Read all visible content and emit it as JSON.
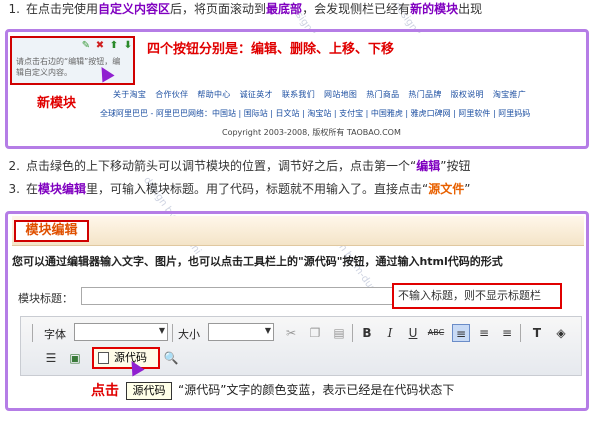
{
  "steps": [
    {
      "num": "1.",
      "pre": "在点击完使用",
      "h1": "自定义内容区",
      "mid1": "后，将页面滚动到",
      "h2": "最底部",
      "mid2": "，会发现侧栏已经有",
      "h3": "新的模块",
      "post": "出现"
    },
    {
      "num": "2.",
      "pre": "点击绿色的上下移动箭头可以调节模块的位置，调节好之后，点击第一个“",
      "h1": "编辑",
      "post": "”按钮"
    },
    {
      "num": "3.",
      "pre": "在",
      "h1": "模块编辑",
      "mid1": "里，可输入模块标题。用了代码，标题就不用输入了。直接点击“",
      "h2": "源文件",
      "post": "”"
    }
  ],
  "panel1": {
    "callout": "四个按钮分别是：编辑、删除、上移、下移",
    "new_module_label": "新模块",
    "module_text": "请点击右边的“编辑”按钮，编辑自定义内容。",
    "icons": [
      "edit-icon",
      "delete-icon",
      "move-up-icon",
      "move-down-icon"
    ],
    "footer_links": [
      "关于淘宝",
      "合作伙伴",
      "帮助中心",
      "诚征英才",
      "联系我们",
      "网站地图",
      "热门商品",
      "热门品牌",
      "版权说明",
      "淘宝推广"
    ],
    "footer_line2": "全球阿里巴巴 - 阿里巴巴网络：中国站 | 国际站 | 日文站 | 淘宝站 | 支付宝 | 中国雅虎 | 雅虎口碑网 | 阿里软件 | 阿里妈妈",
    "copyright": "Copyright 2003-2008, 版权所有 TAOBAO.COM"
  },
  "panel2": {
    "title": "模块编辑",
    "description": "您可以通过编辑器输入文字、图片，也可以点击工具栏上的\"源代码\"按钮，通过输入html代码的形式",
    "title_field_label": "模块标题：",
    "title_field_value": "",
    "title_note": "不输入标题，则不显示标题栏",
    "toolbar": {
      "font_label": "字体",
      "size_label": "大小",
      "source_button": "源代码",
      "tooltip": "源代码"
    },
    "click_label": "点击",
    "bottom_note": "“源代码”文字的颜色变蓝，表示已经是在代码状态下"
  },
  "watermark": "design by m-dushi",
  "colors": {
    "accent_purple": "#8000c0",
    "accent_orange": "#e86000",
    "alert_red": "#e00000",
    "box_purple": "#b57de6"
  }
}
